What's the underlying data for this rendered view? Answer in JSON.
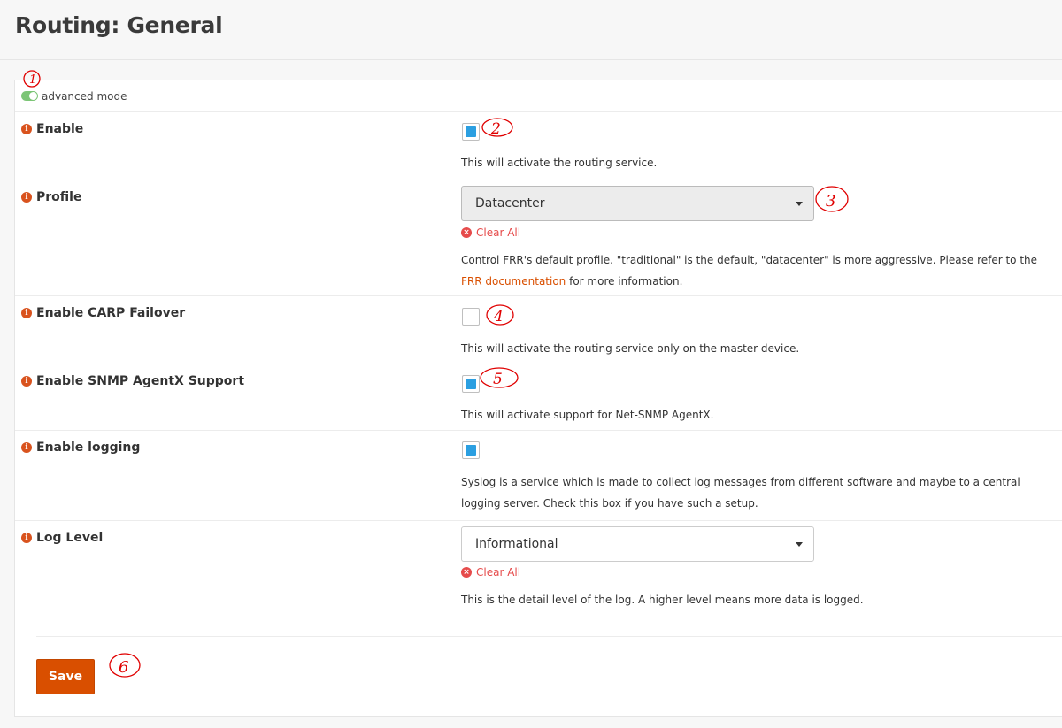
{
  "page": {
    "title": "Routing: General"
  },
  "advanced_mode": {
    "label": "advanced mode",
    "enabled": true
  },
  "fields": {
    "enable": {
      "label": "Enable",
      "checked": true,
      "help": "This will activate the routing service."
    },
    "profile": {
      "label": "Profile",
      "value": "Datacenter",
      "clear_label": "Clear All",
      "help_line1": "Control FRR's default profile. \"traditional\" is the default, \"datacenter\" is more aggressive. Please refer to the",
      "help_link": "FRR documentation",
      "help_line2": " for more information."
    },
    "carp": {
      "label": "Enable CARP Failover",
      "checked": false,
      "help": "This will activate the routing service only on the master device."
    },
    "snmp": {
      "label": "Enable SNMP AgentX Support",
      "checked": true,
      "help": "This will activate support for Net-SNMP AgentX."
    },
    "logging": {
      "label": "Enable logging",
      "checked": true,
      "help_line1": "Syslog is a service which is made to collect log messages from different software and maybe to a central",
      "help_line2": "logging server. Check this box if you have such a setup."
    },
    "log_level": {
      "label": "Log Level",
      "value": "Informational",
      "clear_label": "Clear All",
      "help": "This is the detail level of the log. A higher level means more data is logged."
    }
  },
  "actions": {
    "save_label": "Save"
  },
  "annotations": {
    "n1": "1",
    "n2": "2",
    "n3": "3",
    "n4": "4",
    "n5": "5",
    "n6": "6"
  },
  "colors": {
    "accent": "#d94f00",
    "checkbox": "#2b9fe1",
    "clear": "#e64b4b",
    "toggle": "#7cc576",
    "annotation": "#e00000"
  }
}
